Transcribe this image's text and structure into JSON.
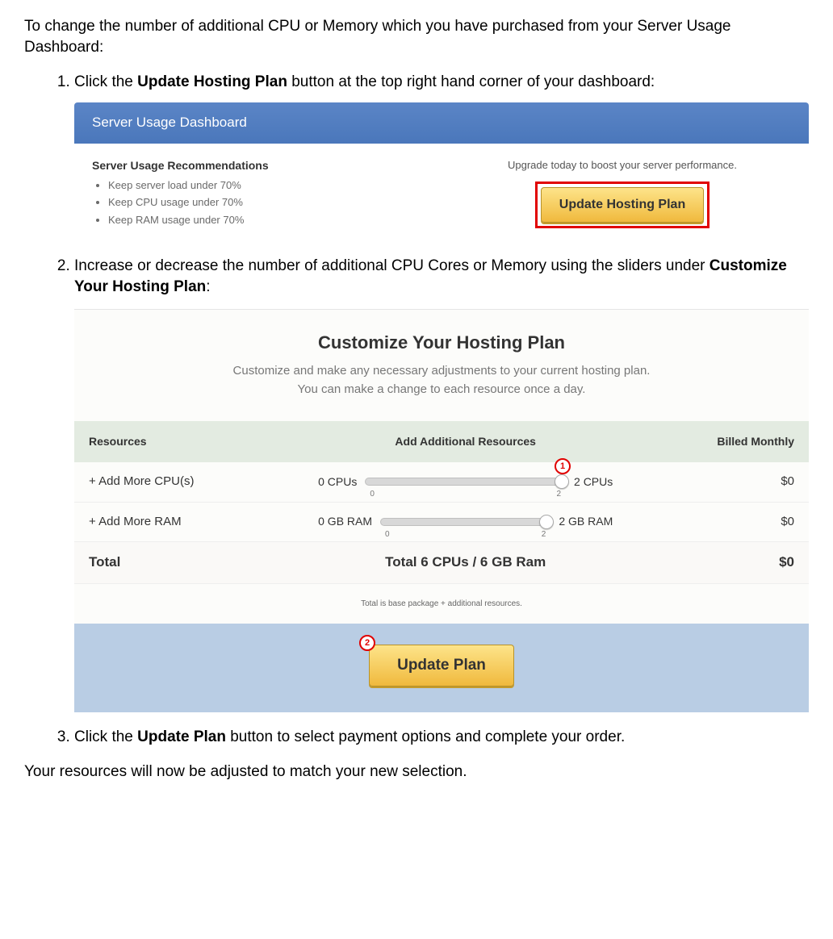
{
  "intro": "To change the number of additional CPU or Memory which you have purchased from your Server Usage Dashboard:",
  "steps": {
    "s1_pre": "Click the ",
    "s1_bold": "Update Hosting Plan",
    "s1_post": " button at the top right hand corner of your dashboard:",
    "s2_pre": "Increase or decrease the number of additional CPU Cores or Memory using the sliders under ",
    "s2_bold": "Customize Your Hosting Plan",
    "s2_post": ":",
    "s3_pre": "Click the ",
    "s3_bold": "Update Plan",
    "s3_post": " button to select payment options and complete your order."
  },
  "panel1": {
    "header": "Server Usage Dashboard",
    "rec_title": "Server Usage Recommendations",
    "recs": [
      "Keep server load under 70%",
      "Keep CPU usage under 70%",
      "Keep RAM usage under 70%"
    ],
    "upgrade_text": "Upgrade today to boost your server performance.",
    "button": "Update Hosting Plan"
  },
  "panel2": {
    "title": "Customize Your Hosting Plan",
    "sub1": "Customize and make any necessary adjustments to your current hosting plan.",
    "sub2": "You can make a change to each resource once a day.",
    "headers": {
      "resources": "Resources",
      "add": "Add Additional Resources",
      "billed": "Billed Monthly"
    },
    "rows": [
      {
        "label": "+ Add More CPU(s)",
        "min": "0 CPUs",
        "max": "2 CPUs",
        "tick_min": "0",
        "tick_max": "2",
        "price": "$0",
        "thumb_pos": "right",
        "callout": "1"
      },
      {
        "label": "+ Add More RAM",
        "min": "0 GB RAM",
        "max": "2 GB RAM",
        "tick_min": "0",
        "tick_max": "2",
        "price": "$0",
        "thumb_pos": "right",
        "callout": null
      }
    ],
    "total_label": "Total",
    "total_summary": "Total 6 CPUs / 6 GB Ram",
    "total_price": "$0",
    "footnote": "Total is base package + additional resources.",
    "update_button": "Update Plan",
    "update_callout": "2"
  },
  "closing": "Your resources will now be adjusted to match your new selection."
}
